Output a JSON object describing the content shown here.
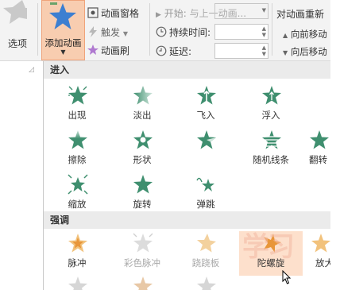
{
  "ribbon": {
    "options_label": "选项",
    "add_animation_label": "添加动画",
    "animation_pane_label": "动画窗格",
    "trigger_label": "触发",
    "animation_painter_label": "动画刷",
    "start_label": "开始:",
    "start_value": "与上一动画...",
    "duration_label": "持续时间:",
    "delay_label": "延迟:",
    "reorder_title": "对动画重新",
    "move_earlier_label": "向前移动",
    "move_later_label": "向后移动"
  },
  "gallery": {
    "entrance_header": "进入",
    "entrance_items": [
      {
        "label": "出现",
        "icon": "appear-star-icon"
      },
      {
        "label": "淡出",
        "icon": "fade-star-icon"
      },
      {
        "label": "飞入",
        "icon": "fly-in-star-icon"
      },
      {
        "label": "浮入",
        "icon": "float-in-star-icon"
      },
      {
        "label": "擦除",
        "icon": "wipe-star-icon"
      },
      {
        "label": "形状",
        "icon": "shape-star-icon"
      },
      {
        "label": "",
        "icon": "wheel-star-icon"
      },
      {
        "label": "随机线条",
        "icon": "random-bars-star-icon"
      },
      {
        "label": "翻转",
        "icon": "flip-star-icon"
      },
      {
        "label": "缩放",
        "icon": "zoom-star-icon"
      },
      {
        "label": "旋转",
        "icon": "swivel-star-icon"
      },
      {
        "label": "弹跳",
        "icon": "bounce-star-icon"
      }
    ],
    "emphasis_header": "强调",
    "emphasis_items": [
      {
        "label": "脉冲",
        "icon": "pulse-star-icon"
      },
      {
        "label": "彩色脉冲",
        "icon": "color-pulse-star-icon"
      },
      {
        "label": "跷跷板",
        "icon": "teeter-star-icon"
      },
      {
        "label": "陀螺旋",
        "icon": "spin-star-icon"
      },
      {
        "label": "放大",
        "icon": "grow-star-icon"
      }
    ],
    "watermark": "学习"
  },
  "colors": {
    "entrance_green": "#3f8f6f",
    "emphasis_orange": "#e8963a",
    "highlight": "#f8cdb0"
  }
}
